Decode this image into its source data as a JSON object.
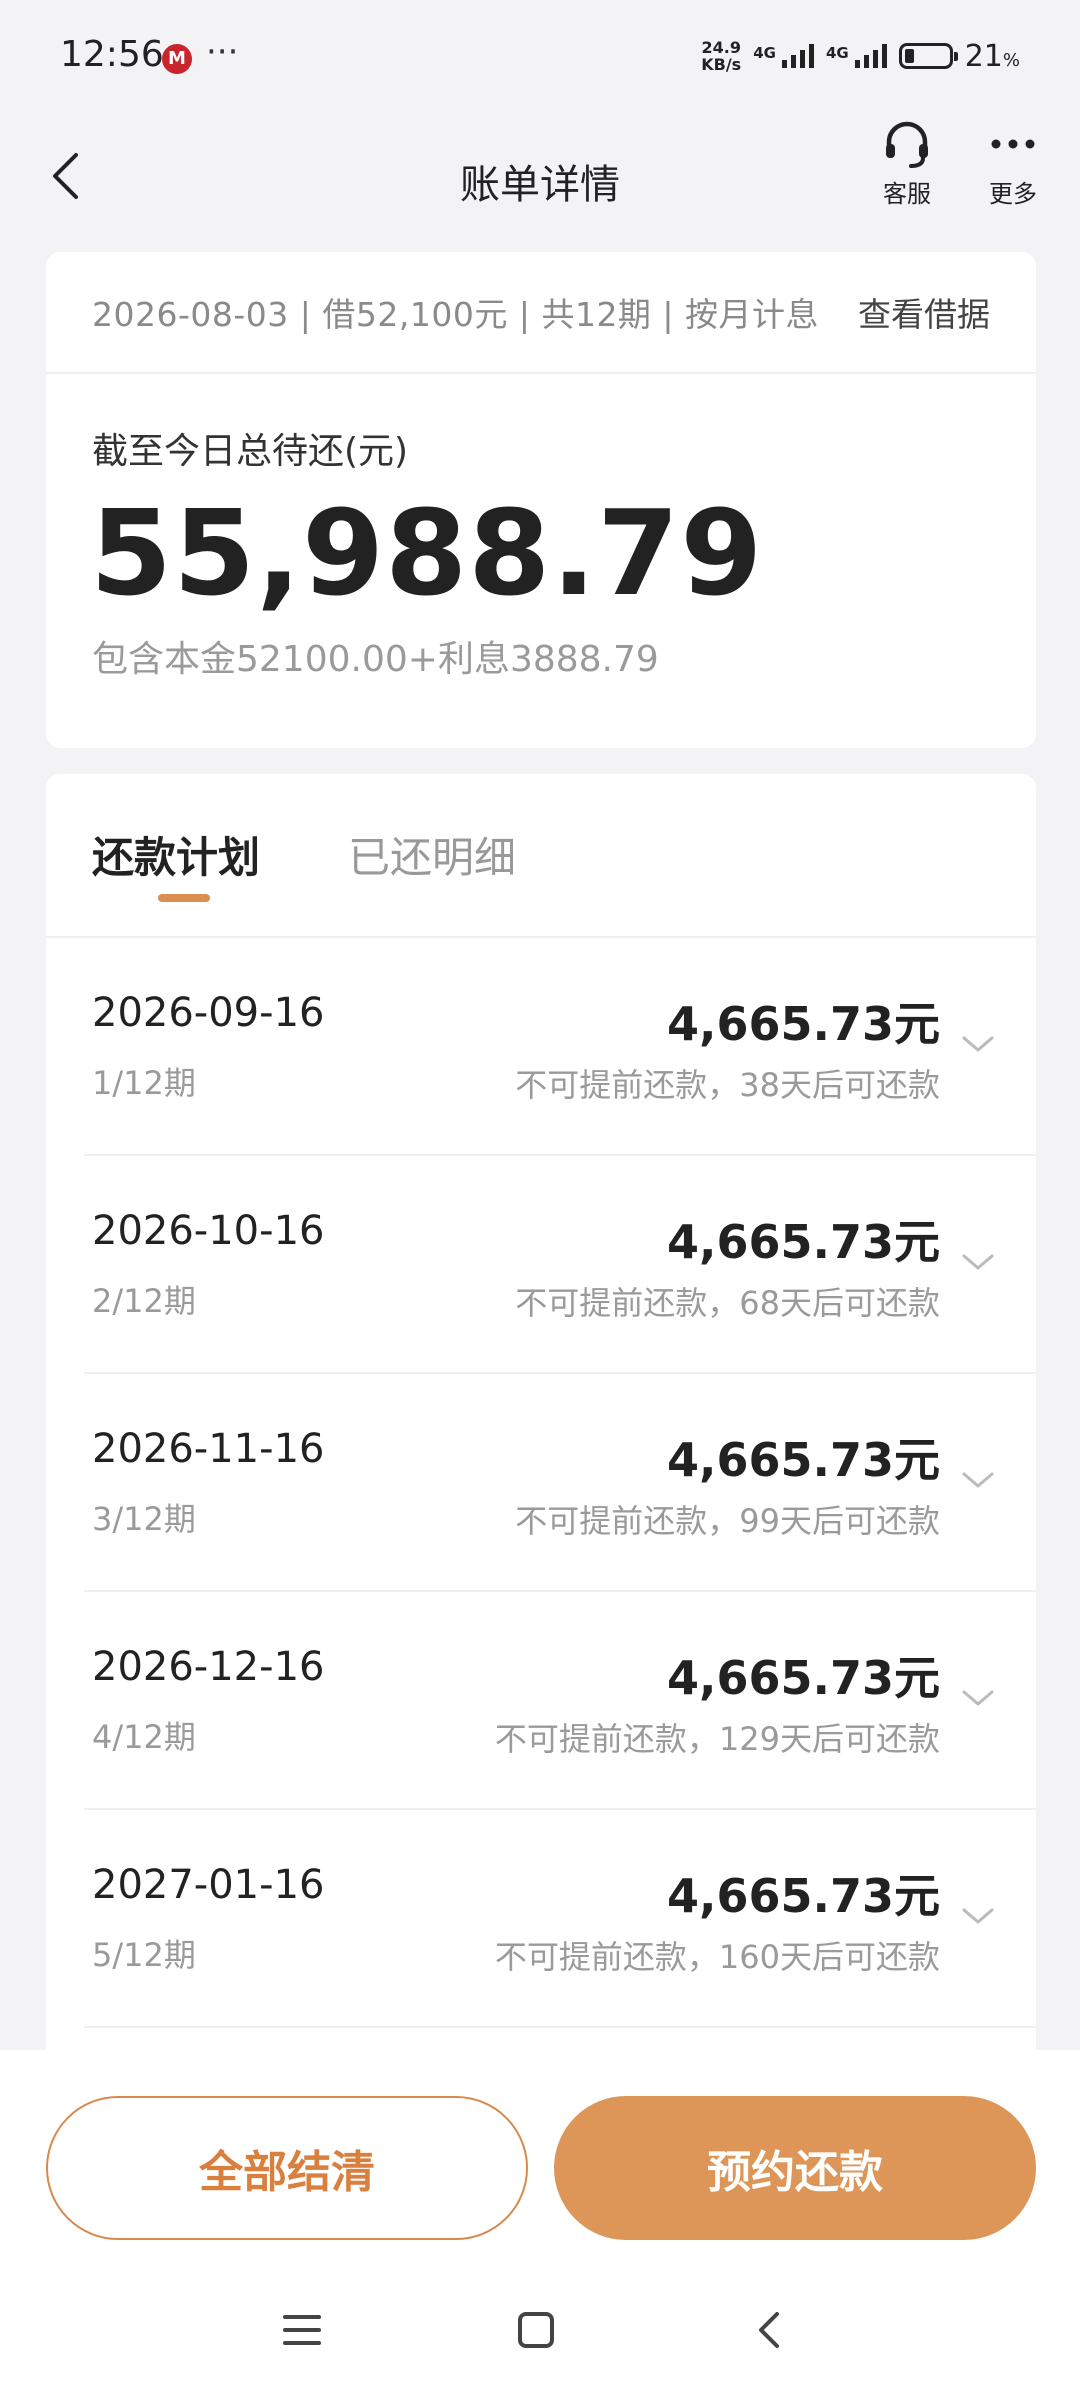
{
  "status_bar": {
    "time": "12:56",
    "app_badge": "M",
    "dots": "···",
    "net_speed_value": "24.9",
    "net_speed_unit": "KB/s",
    "sig1_label": "4G",
    "sig2_label": "4G",
    "battery_level_pct": 21,
    "battery_text": "21",
    "battery_unit": "%"
  },
  "header": {
    "title": "账单详情",
    "service_label": "客服",
    "more_label": "更多"
  },
  "summary": {
    "loan_info": "2026-08-03 | 借52,100元 | 共12期 | 按月计息",
    "view_contract": "查看借据",
    "total_label": "截至今日总待还(元)",
    "total_amount": "55,988.79",
    "breakdown": "包含本金52100.00+利息3888.79"
  },
  "tabs": {
    "plan": "还款计划",
    "detail": "已还明细"
  },
  "schedule": [
    {
      "date": "2026-09-16",
      "period": "1/12期",
      "amount": "4,665.73元",
      "note": "不可提前还款，38天后可还款"
    },
    {
      "date": "2026-10-16",
      "period": "2/12期",
      "amount": "4,665.73元",
      "note": "不可提前还款，68天后可还款"
    },
    {
      "date": "2026-11-16",
      "period": "3/12期",
      "amount": "4,665.73元",
      "note": "不可提前还款，99天后可还款"
    },
    {
      "date": "2026-12-16",
      "period": "4/12期",
      "amount": "4,665.73元",
      "note": "不可提前还款，129天后可还款"
    },
    {
      "date": "2027-01-16",
      "period": "5/12期",
      "amount": "4,665.73元",
      "note": "不可提前还款，160天后可还款"
    }
  ],
  "actions": {
    "clear_all": "全部结清",
    "reserve": "预约还款"
  },
  "colors": {
    "accent": "#dd9658",
    "accent_text": "#d9803f"
  }
}
